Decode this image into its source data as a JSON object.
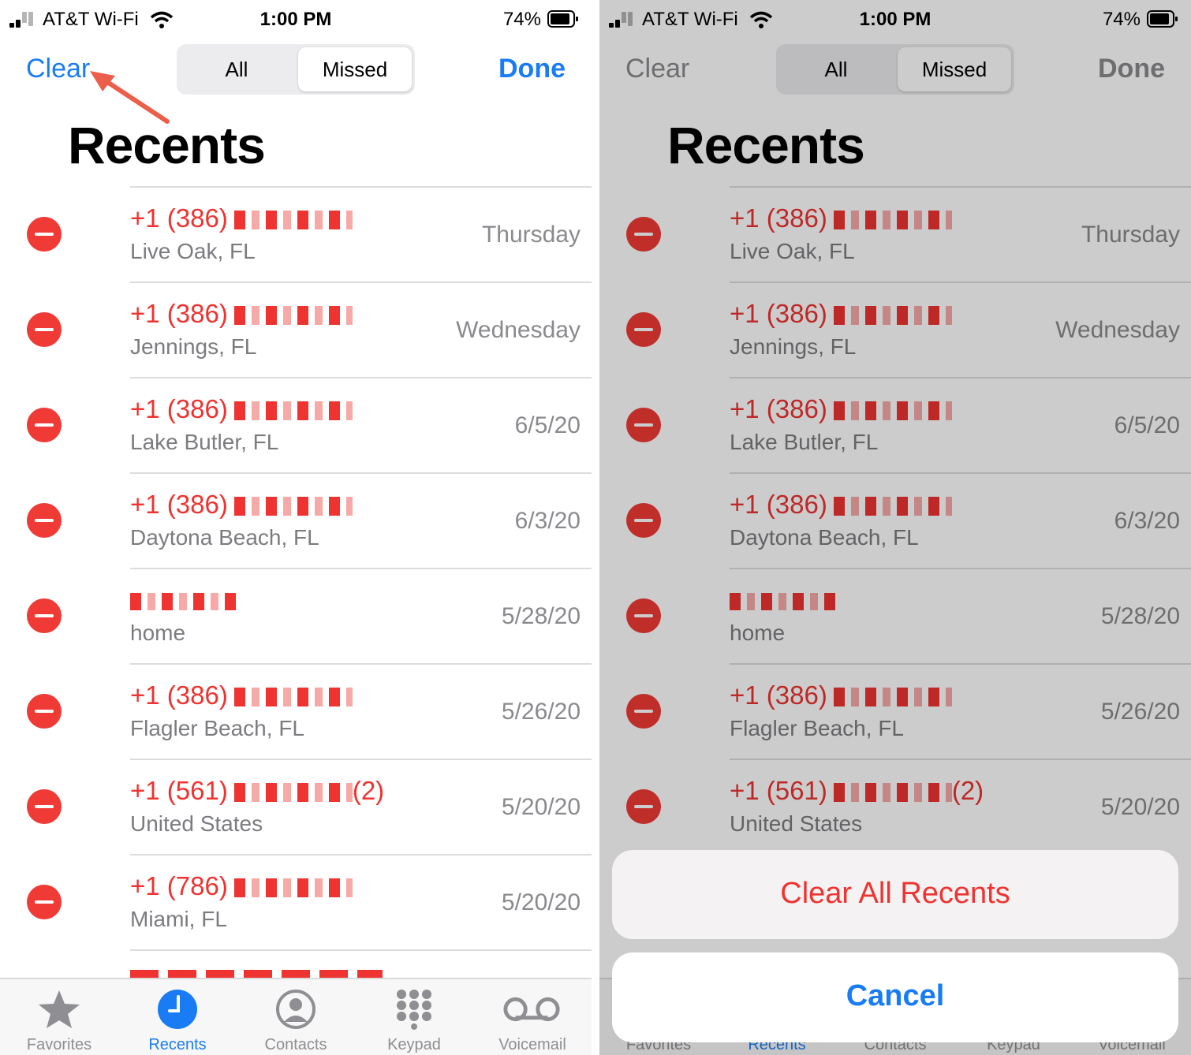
{
  "status": {
    "carrier": "AT&T Wi-Fi",
    "time": "1:00 PM",
    "battery": "74%"
  },
  "nav": {
    "clear": "Clear",
    "done": "Done",
    "segments": [
      "All",
      "Missed"
    ],
    "selected_segment": "Missed"
  },
  "title": "Recents",
  "recents": [
    {
      "number": "+1 (386)",
      "location": "Live Oak, FL",
      "date": "Thursday"
    },
    {
      "number": "+1 (386)",
      "location": "Jennings, FL",
      "date": "Wednesday"
    },
    {
      "number": "+1 (386)",
      "location": "Lake Butler, FL",
      "date": "6/5/20"
    },
    {
      "number": "+1 (386)",
      "location": "Daytona Beach, FL",
      "date": "6/3/20"
    },
    {
      "number": "",
      "location": "home",
      "date": "5/28/20"
    },
    {
      "number": "+1 (386)",
      "location": "Flagler Beach, FL",
      "date": "5/26/20"
    },
    {
      "number": "+1 (561)",
      "count": "(2)",
      "location": "United States",
      "date": "5/20/20"
    },
    {
      "number": "+1 (786)",
      "location": "Miami, FL",
      "date": "5/20/20"
    }
  ],
  "tabs": [
    {
      "label": "Favorites",
      "icon": "star-icon"
    },
    {
      "label": "Recents",
      "icon": "clock-icon",
      "active": true
    },
    {
      "label": "Contacts",
      "icon": "person-circle-icon"
    },
    {
      "label": "Keypad",
      "icon": "keypad-icon"
    },
    {
      "label": "Voicemail",
      "icon": "voicemail-icon"
    }
  ],
  "action_sheet": {
    "clear_all": "Clear All Recents",
    "cancel": "Cancel"
  },
  "colors": {
    "accent": "#1a7cf5",
    "missed_red": "#ee3330",
    "delete_red": "#f03a35"
  }
}
